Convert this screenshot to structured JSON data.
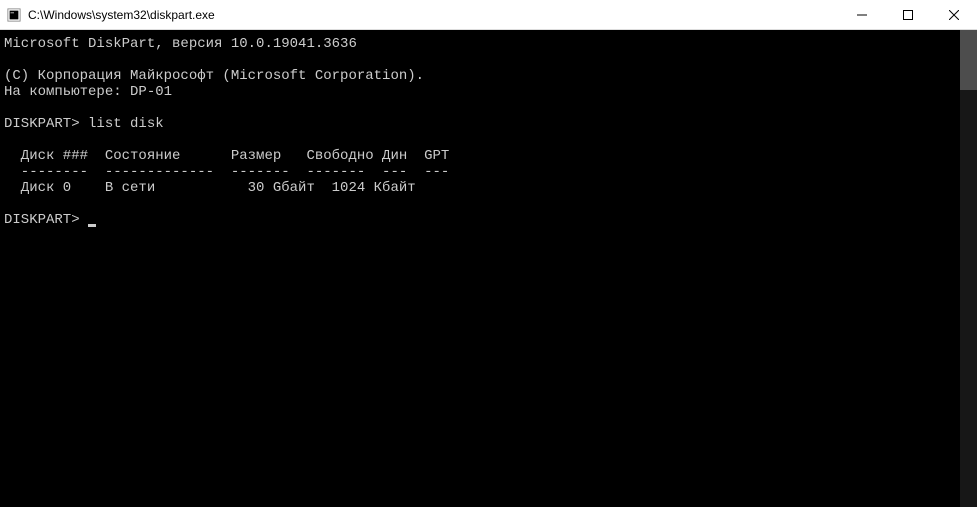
{
  "titlebar": {
    "title": "C:\\Windows\\system32\\diskpart.exe"
  },
  "console": {
    "header_line": "Microsoft DiskPart, версия 10.0.19041.3636",
    "copyright": "(C) Корпорация Майкрософт (Microsoft Corporation).",
    "computer_line": "На компьютере: DP-01",
    "prompt1": "DISKPART> list disk",
    "table_header": "  Диск ###  Состояние      Размер   Свободно Дин  GPT",
    "table_divider": "  --------  -------------  -------  -------  ---  ---",
    "table_row1": "  Диск 0    В сети           30 Gбайт  1024 Кбайт",
    "prompt2": "DISKPART> "
  }
}
